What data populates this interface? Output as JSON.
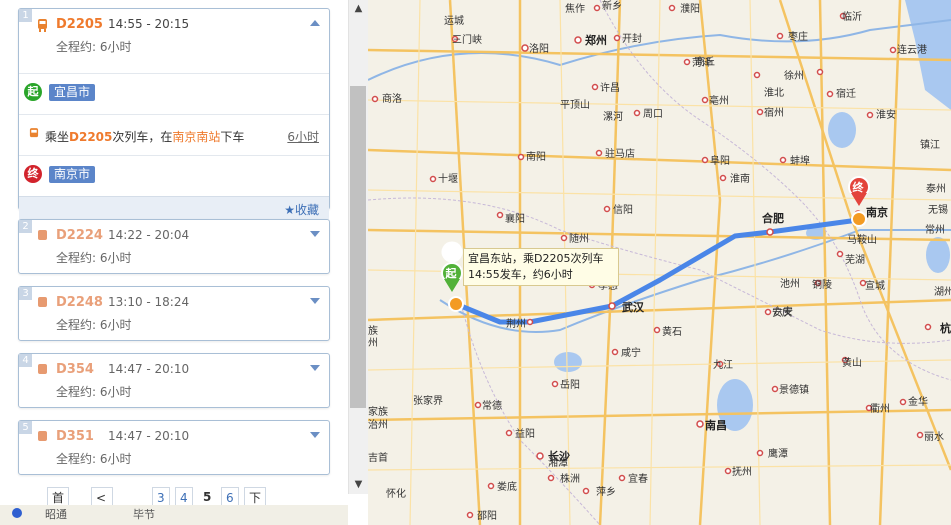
{
  "routes": [
    {
      "index": "1",
      "code": "D2205",
      "time": "14:55 - 20:15",
      "duration": "全程约: 6小时",
      "expanded": true,
      "start_badge": "起",
      "start_place": "宜昌市",
      "ride_prefix": "乘坐",
      "ride_code": "D2205",
      "ride_mid": "次列车，在",
      "ride_station": "南京南站",
      "ride_suffix": "下车",
      "ride_duration": "6小时",
      "end_badge": "终",
      "end_place": "南京市",
      "favorite": "收藏"
    },
    {
      "index": "2",
      "code": "D2224",
      "time": "14:22 - 20:04",
      "duration": "全程约: 6小时"
    },
    {
      "index": "3",
      "code": "D2248",
      "time": "13:10 - 18:24",
      "duration": "全程约: 6小时"
    },
    {
      "index": "4",
      "code": "D354",
      "time": "14:47 - 20:10",
      "duration": "全程约: 6小时"
    },
    {
      "index": "5",
      "code": "D351",
      "time": "14:47 - 20:10",
      "duration": "全程约: 6小时"
    }
  ],
  "pager": {
    "first": "首页",
    "prev": "<上一页",
    "p3": "3",
    "p4": "4",
    "p5": "5",
    "p6": "6",
    "next": "下一页>"
  },
  "bottom_strip": [
    "昭通",
    "毕节"
  ],
  "map": {
    "popup_line1": "宜昌东站，乘D2205次列车",
    "popup_line2": "14:55发车，约6小时",
    "start_marker": "起",
    "end_marker": "终",
    "route_color": "#4a86e8",
    "cities": [
      "运城",
      "三门峡",
      "洛阳",
      "焦作",
      "郑州",
      "新乡",
      "开封",
      "濮阳",
      "菏泽",
      "枣庄",
      "临沂",
      "连云港",
      "徐州",
      "商丘",
      "宿迁",
      "淮北",
      "蚌埠",
      "淮安",
      "许昌",
      "周口",
      "亳州",
      "阜阳",
      "宿州",
      "漯河",
      "平顶山",
      "驻马店",
      "南阳",
      "商洛",
      "十堰",
      "襄阳",
      "信阳",
      "随州",
      "孝感",
      "荆州",
      "武汉",
      "黄石",
      "咸宁",
      "岳阳",
      "常德",
      "益阳",
      "长沙",
      "张家界",
      "合肥",
      "六安",
      "淮南",
      "滁州",
      "南京",
      "马鞍山",
      "芜湖",
      "泰州",
      "常州",
      "湖州",
      "杭州",
      "宣城",
      "铜陵",
      "安庆",
      "池州",
      "黄山",
      "九江",
      "景德镇",
      "南昌",
      "衢州",
      "金华",
      "丽水",
      "鹰潭",
      "抚州",
      "宜春",
      "萍乡",
      "株洲",
      "湘潭",
      "娄底",
      "邵阳",
      "怀化",
      "吉首",
      "恩施",
      "宜昌",
      "镇江",
      "无锡",
      "扬州"
    ]
  }
}
